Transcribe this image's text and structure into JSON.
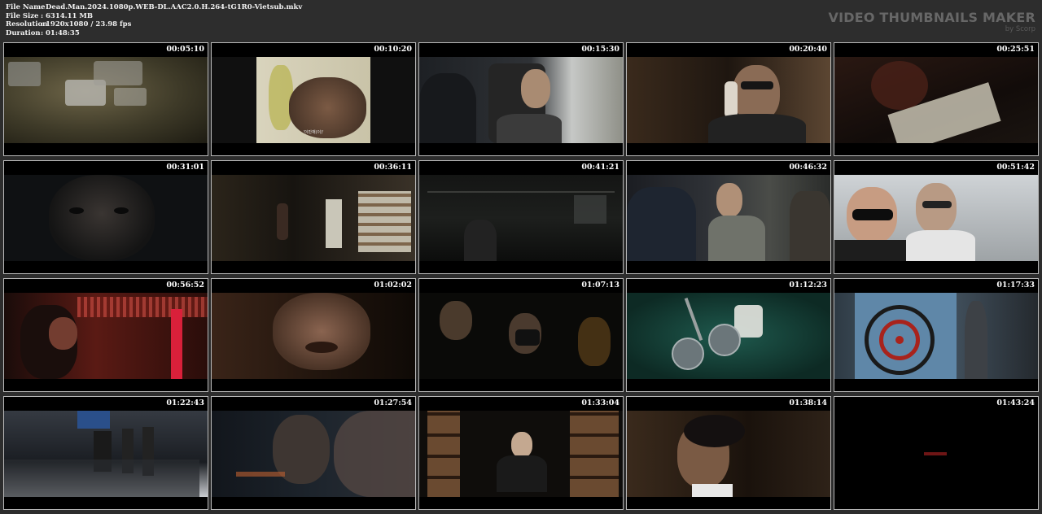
{
  "info": {
    "rows": [
      {
        "key": "File Name",
        "value": "Dead.Man.2024.1080p.WEB-DL.AAC2.0.H.264-tG1R0-Vietsub.mkv"
      },
      {
        "key": "File Size",
        "value": "6314.11 MB"
      },
      {
        "key": "Resolution",
        "value": "1920x1080 / 23.98 fps"
      },
      {
        "key": "Duration",
        "value": "01:48:35"
      }
    ],
    "separator": ":"
  },
  "brand": {
    "title": "VIDEO THUMBNAILS MAKER",
    "subtitle": "by Scorp"
  },
  "thumbnails": [
    {
      "time": "00:05:10"
    },
    {
      "time": "00:10:20",
      "subtitle": "'이만재(이)'"
    },
    {
      "time": "00:15:30"
    },
    {
      "time": "00:20:40"
    },
    {
      "time": "00:25:51"
    },
    {
      "time": "00:31:01"
    },
    {
      "time": "00:36:11"
    },
    {
      "time": "00:41:21"
    },
    {
      "time": "00:46:32"
    },
    {
      "time": "00:51:42"
    },
    {
      "time": "00:56:52"
    },
    {
      "time": "01:02:02"
    },
    {
      "time": "01:07:13"
    },
    {
      "time": "01:12:23"
    },
    {
      "time": "01:17:33"
    },
    {
      "time": "01:22:43"
    },
    {
      "time": "01:27:54"
    },
    {
      "time": "01:33:04"
    },
    {
      "time": "01:38:14"
    },
    {
      "time": "01:43:24"
    }
  ]
}
